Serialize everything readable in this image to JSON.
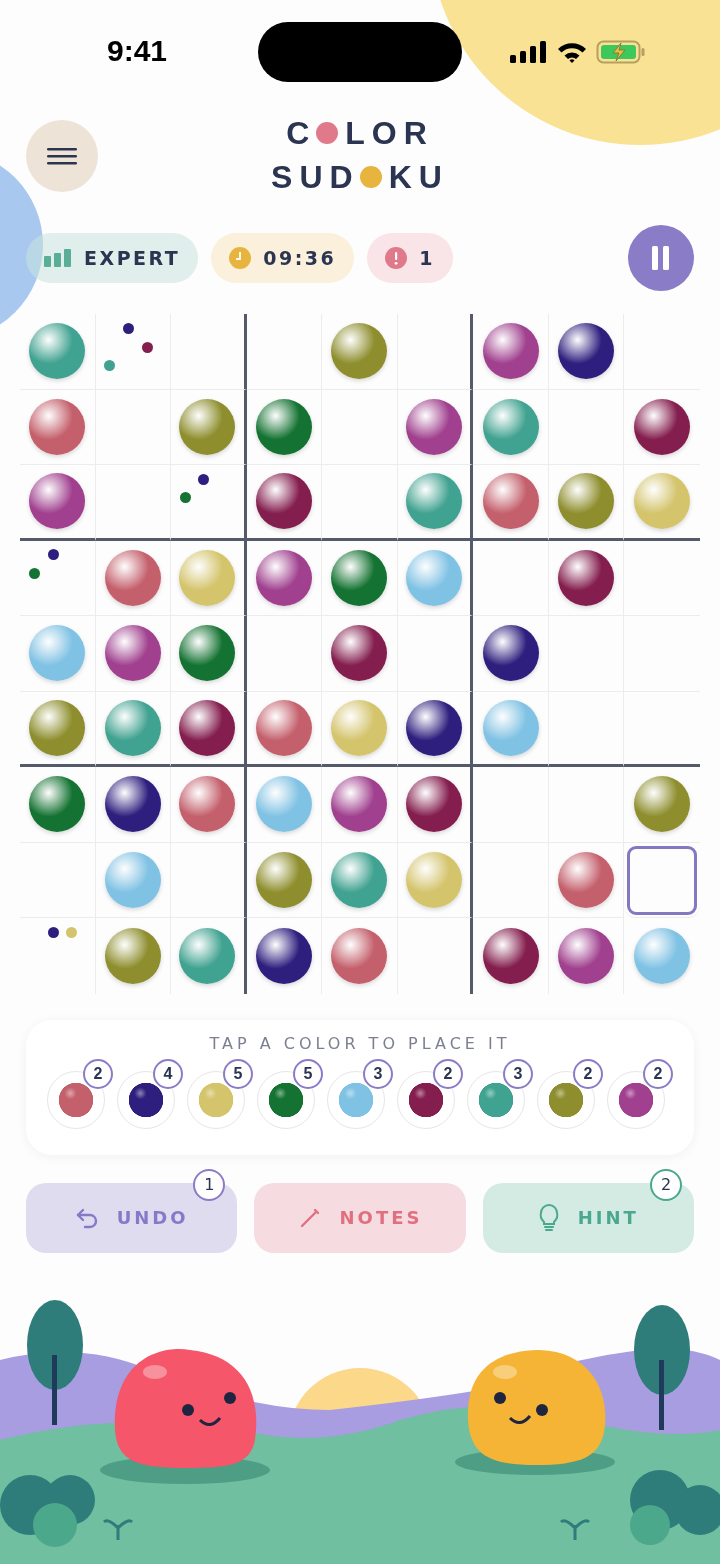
{
  "status_bar": {
    "time": "9:41"
  },
  "title_lines": [
    {
      "before": "C",
      "after": "LOR",
      "color": "#e07a8a"
    },
    {
      "before": "SUD",
      "after": "KU",
      "color": "#e8b440"
    }
  ],
  "chips": [
    {
      "kind": "difficulty",
      "label": "EXPERT"
    },
    {
      "kind": "timer",
      "label": "09:36"
    },
    {
      "kind": "mistakes",
      "label": "1"
    }
  ],
  "palette": [
    {
      "color": "#c4606c",
      "count": "2"
    },
    {
      "color": "#2e1f7e",
      "count": "4"
    },
    {
      "color": "#d4c46c",
      "count": "5"
    },
    {
      "color": "#147232",
      "count": "5"
    },
    {
      "color": "#80c2e4",
      "count": "3"
    },
    {
      "color": "#841e4e",
      "count": "2"
    },
    {
      "color": "#40a290",
      "count": "3"
    },
    {
      "color": "#8e8e2e",
      "count": "2"
    },
    {
      "color": "#a0408e",
      "count": "2"
    }
  ],
  "grid": [
    [
      {
        "kind": "ball",
        "color": "#40a290",
        "selected": false
      },
      {
        "kind": "notes",
        "notes": [
          {
            "color": "#2e1f7e"
          },
          {
            "color": "#841e4e"
          },
          {
            "color": "#40a290"
          }
        ],
        "selected": false
      },
      {
        "kind": "empty",
        "selected": false
      },
      {
        "kind": "empty",
        "selected": false
      },
      {
        "kind": "ball",
        "color": "#8e8e2e",
        "selected": false
      },
      {
        "kind": "empty",
        "selected": false
      },
      {
        "kind": "ball",
        "color": "#a0408e",
        "selected": false
      },
      {
        "kind": "ball",
        "color": "#2e1f7e",
        "selected": false
      },
      {
        "kind": "empty",
        "selected": false
      }
    ],
    [
      {
        "kind": "ball",
        "color": "#c4606c",
        "selected": false
      },
      {
        "kind": "empty",
        "selected": false
      },
      {
        "kind": "ball",
        "color": "#8e8e2e",
        "selected": false
      },
      {
        "kind": "ball",
        "color": "#147232",
        "selected": false
      },
      {
        "kind": "empty",
        "selected": false
      },
      {
        "kind": "ball",
        "color": "#a0408e",
        "selected": false
      },
      {
        "kind": "ball",
        "color": "#40a290",
        "selected": false
      },
      {
        "kind": "empty",
        "selected": false
      },
      {
        "kind": "ball",
        "color": "#841e4e",
        "selected": false
      }
    ],
    [
      {
        "kind": "ball",
        "color": "#a0408e",
        "selected": false
      },
      {
        "kind": "empty",
        "selected": false
      },
      {
        "kind": "notes",
        "notes": [
          {
            "color": "#2e1f7e"
          },
          {
            "color": "#147232"
          }
        ],
        "selected": false
      },
      {
        "kind": "ball",
        "color": "#841e4e",
        "selected": false
      },
      {
        "kind": "empty",
        "selected": false
      },
      {
        "kind": "ball",
        "color": "#40a290",
        "selected": false
      },
      {
        "kind": "ball",
        "color": "#c4606c",
        "selected": false
      },
      {
        "kind": "ball",
        "color": "#8e8e2e",
        "selected": false
      },
      {
        "kind": "ball",
        "color": "#d4c46c",
        "selected": false
      }
    ],
    [
      {
        "kind": "notes",
        "notes": [
          {
            "color": "#2e1f7e"
          },
          {
            "color": "#147232"
          }
        ],
        "selected": false
      },
      {
        "kind": "ball",
        "color": "#c4606c",
        "selected": false
      },
      {
        "kind": "ball",
        "color": "#d4c46c",
        "selected": false
      },
      {
        "kind": "ball",
        "color": "#a0408e",
        "selected": false
      },
      {
        "kind": "ball",
        "color": "#147232",
        "selected": false
      },
      {
        "kind": "ball",
        "color": "#80c2e4",
        "selected": false
      },
      {
        "kind": "empty",
        "selected": false
      },
      {
        "kind": "ball",
        "color": "#841e4e",
        "selected": false
      },
      {
        "kind": "empty",
        "selected": false
      }
    ],
    [
      {
        "kind": "ball",
        "color": "#80c2e4",
        "selected": false
      },
      {
        "kind": "ball",
        "color": "#a0408e",
        "selected": false
      },
      {
        "kind": "ball",
        "color": "#147232",
        "selected": false
      },
      {
        "kind": "empty",
        "selected": false
      },
      {
        "kind": "ball",
        "color": "#841e4e",
        "selected": false
      },
      {
        "kind": "empty",
        "selected": false
      },
      {
        "kind": "ball",
        "color": "#2e1f7e",
        "selected": false
      },
      {
        "kind": "empty",
        "selected": false
      },
      {
        "kind": "empty",
        "selected": false
      }
    ],
    [
      {
        "kind": "ball",
        "color": "#8e8e2e",
        "selected": false
      },
      {
        "kind": "ball",
        "color": "#40a290",
        "selected": false
      },
      {
        "kind": "ball",
        "color": "#841e4e",
        "selected": false
      },
      {
        "kind": "ball",
        "color": "#c4606c",
        "selected": false
      },
      {
        "kind": "ball",
        "color": "#d4c46c",
        "selected": false
      },
      {
        "kind": "ball",
        "color": "#2e1f7e",
        "selected": false
      },
      {
        "kind": "ball",
        "color": "#80c2e4",
        "selected": false
      },
      {
        "kind": "empty",
        "selected": false
      },
      {
        "kind": "empty",
        "selected": false
      }
    ],
    [
      {
        "kind": "ball",
        "color": "#147232",
        "selected": false
      },
      {
        "kind": "ball",
        "color": "#2e1f7e",
        "selected": false
      },
      {
        "kind": "ball",
        "color": "#c4606c",
        "selected": false
      },
      {
        "kind": "ball",
        "color": "#80c2e4",
        "selected": false
      },
      {
        "kind": "ball",
        "color": "#a0408e",
        "selected": false
      },
      {
        "kind": "ball",
        "color": "#841e4e",
        "selected": false
      },
      {
        "kind": "empty",
        "selected": false
      },
      {
        "kind": "empty",
        "selected": false
      },
      {
        "kind": "ball",
        "color": "#8e8e2e",
        "selected": false
      }
    ],
    [
      {
        "kind": "empty",
        "selected": false
      },
      {
        "kind": "ball",
        "color": "#80c2e4",
        "selected": false
      },
      {
        "kind": "empty",
        "selected": false
      },
      {
        "kind": "ball",
        "color": "#8e8e2e",
        "selected": false
      },
      {
        "kind": "ball",
        "color": "#40a290",
        "selected": false
      },
      {
        "kind": "ball",
        "color": "#d4c46c",
        "selected": false
      },
      {
        "kind": "empty",
        "selected": false
      },
      {
        "kind": "ball",
        "color": "#c4606c",
        "selected": false
      },
      {
        "kind": "empty",
        "selected": true
      }
    ],
    [
      {
        "kind": "notes",
        "notes": [
          {
            "color": "#2e1f7e"
          },
          {
            "color": "#d4c46c"
          }
        ],
        "selected": false
      },
      {
        "kind": "ball",
        "color": "#8e8e2e",
        "selected": false
      },
      {
        "kind": "ball",
        "color": "#40a290",
        "selected": false
      },
      {
        "kind": "ball",
        "color": "#2e1f7e",
        "selected": false
      },
      {
        "kind": "ball",
        "color": "#c4606c",
        "selected": false
      },
      {
        "kind": "empty",
        "selected": false
      },
      {
        "kind": "ball",
        "color": "#841e4e",
        "selected": false
      },
      {
        "kind": "ball",
        "color": "#a0408e",
        "selected": false
      },
      {
        "kind": "ball",
        "color": "#80c2e4",
        "selected": false
      }
    ]
  ],
  "palette_hint": "TAP A COLOR TO PLACE IT",
  "actions": [
    {
      "kind": "undo",
      "label": "UNDO",
      "badge": "1"
    },
    {
      "kind": "notes",
      "label": "NOTES"
    },
    {
      "kind": "hint",
      "label": "HINT",
      "badge": "2"
    }
  ]
}
